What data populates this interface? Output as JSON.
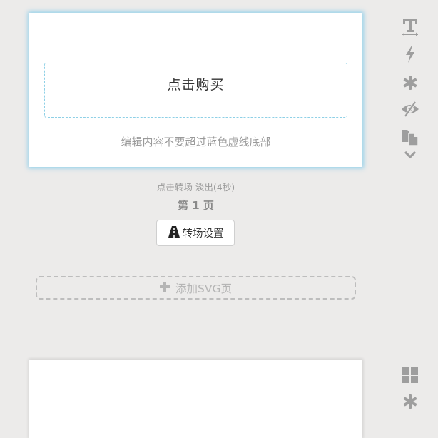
{
  "page1": {
    "edit_zone_text": "点击购买",
    "hint": "编辑内容不要超过蓝色虚线底部"
  },
  "transition_info": "点击转场 淡出(4秒)",
  "page_label": "第 1 页",
  "transition_button": {
    "icon": "road-icon",
    "label": "转场设置"
  },
  "add_svg_button": {
    "icon": "plus-icon",
    "label": "添加SVG页"
  },
  "toolbar_top": [
    {
      "name": "text-icon"
    },
    {
      "name": "lightning-icon"
    },
    {
      "name": "asterisk-icon"
    },
    {
      "name": "eye-slash-icon"
    },
    {
      "name": "copy-icon"
    },
    {
      "name": "chevron-down-icon"
    }
  ],
  "toolbar_bottom": [
    {
      "name": "grid-icon"
    },
    {
      "name": "asterisk-icon"
    }
  ],
  "colors": {
    "background": "#ecebea",
    "accent_dashed": "#8ed0e6",
    "icon_gray": "#9e9e9e"
  }
}
